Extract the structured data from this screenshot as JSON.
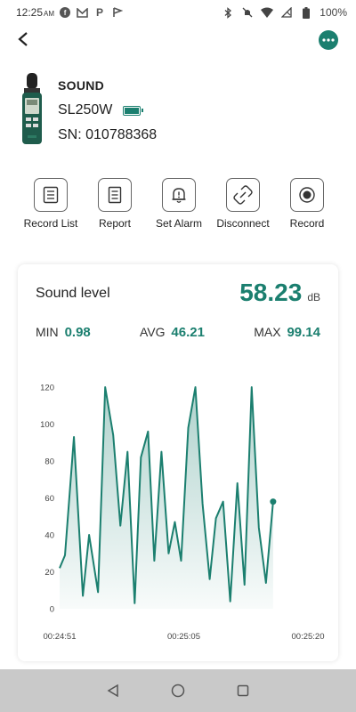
{
  "status_bar": {
    "time": "12:25",
    "am_pm": "AM",
    "battery_text": "100%",
    "notification_icons": [
      "facebook-icon",
      "gmail-icon",
      "p-icon",
      "flag-icon"
    ],
    "system_icons": [
      "bluetooth-icon",
      "mute-icon",
      "wifi-icon",
      "no-signal-icon",
      "battery-icon"
    ]
  },
  "device": {
    "name": "SOUND",
    "model": "SL250W",
    "sn": "SN: 010788368",
    "battery_level": 1.0
  },
  "actions": [
    {
      "label": "Record List",
      "icon": "record-list-icon"
    },
    {
      "label": "Report",
      "icon": "report-icon"
    },
    {
      "label": "Set Alarm",
      "icon": "alarm-bell-icon"
    },
    {
      "label": "Disconnect",
      "icon": "disconnect-icon"
    },
    {
      "label": "Record",
      "icon": "record-icon"
    }
  ],
  "card": {
    "title": "Sound level",
    "value": "58.23",
    "unit": "dB",
    "min_label": "MIN",
    "min_value": "0.98",
    "avg_label": "AVG",
    "avg_value": "46.21",
    "max_label": "MAX",
    "max_value": "99.14"
  },
  "colors": {
    "accent": "#1b7f6f",
    "navbar": "#c9c9c9"
  },
  "chart_data": {
    "type": "area",
    "y_ticks": [
      0,
      20,
      40,
      60,
      80,
      100,
      120
    ],
    "ylim": [
      0,
      120
    ],
    "x_tick_labels": [
      "00:24:51",
      "00:25:05",
      "00:25:20"
    ],
    "x_tick_positions": [
      0,
      13.9,
      27.8
    ],
    "xlim": [
      0,
      27.8
    ],
    "grid": false,
    "x": [
      0,
      0.6,
      1.6,
      2.6,
      3.3,
      4.3,
      5.1,
      6.0,
      6.8,
      7.6,
      8.4,
      9.1,
      9.9,
      10.6,
      11.4,
      12.2,
      12.9,
      13.6,
      14.4,
      15.2,
      16.0,
      16.8,
      17.5,
      18.3,
      19.1,
      19.9,
      20.7,
      21.5,
      22.3,
      23.1,
      23.9,
      24.7,
      25.4,
      26.2,
      26.9,
      27.8
    ],
    "values": [
      22,
      29,
      93,
      7,
      40,
      9,
      120,
      94,
      45,
      85,
      3,
      82,
      96,
      26,
      85,
      30,
      47,
      26,
      98,
      120,
      57,
      16,
      49,
      58,
      4,
      68,
      13,
      120,
      44,
      14,
      58
    ]
  }
}
